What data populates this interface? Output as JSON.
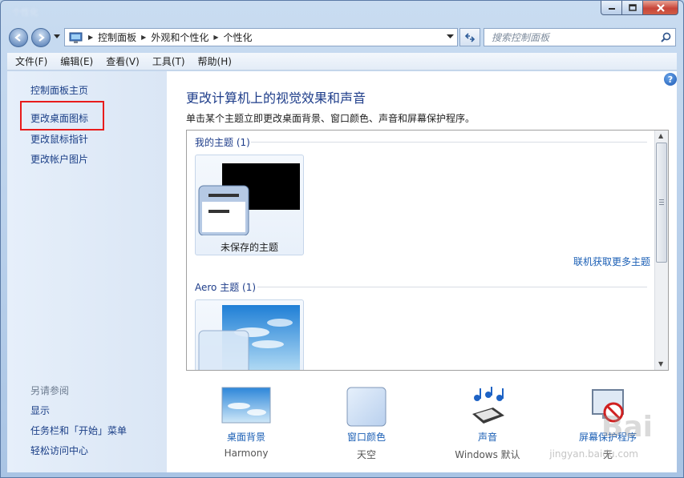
{
  "window": {
    "title": "个性化"
  },
  "address": {
    "crumbs": [
      "控制面板",
      "外观和个性化",
      "个性化"
    ],
    "search_placeholder": "搜索控制面板"
  },
  "menu": [
    "文件(F)",
    "编辑(E)",
    "查看(V)",
    "工具(T)",
    "帮助(H)"
  ],
  "sidebar": {
    "home": "控制面板主页",
    "links": [
      "更改桌面图标",
      "更改鼠标指针",
      "更改帐户图片"
    ],
    "see_also_title": "另请参阅",
    "see_also": [
      "显示",
      "任务栏和「开始」菜单",
      "轻松访问中心"
    ]
  },
  "main": {
    "title": "更改计算机上的视觉效果和声音",
    "description": "单击某个主题立即更改桌面背景、窗口颜色、声音和屏幕保护程序。",
    "my_themes_header": "我的主题 (1)",
    "unsaved_theme": "未保存的主题",
    "more_themes_link": "联机获取更多主题",
    "aero_header": "Aero 主题 (1)"
  },
  "bottom": [
    {
      "label": "桌面背景",
      "value": "Harmony",
      "icon": "desktop-background-icon"
    },
    {
      "label": "窗口颜色",
      "value": "天空",
      "icon": "window-color-icon"
    },
    {
      "label": "声音",
      "value": "Windows 默认",
      "icon": "sound-icon"
    },
    {
      "label": "屏幕保护程序",
      "value": "无",
      "icon": "screensaver-icon"
    }
  ],
  "watermark": {
    "brand": "Bai",
    "url": "jingyan.baidu.com"
  },
  "colors": {
    "highlight": "#e81c1c",
    "link": "#1b5fb5",
    "title": "#1e3d8a"
  }
}
